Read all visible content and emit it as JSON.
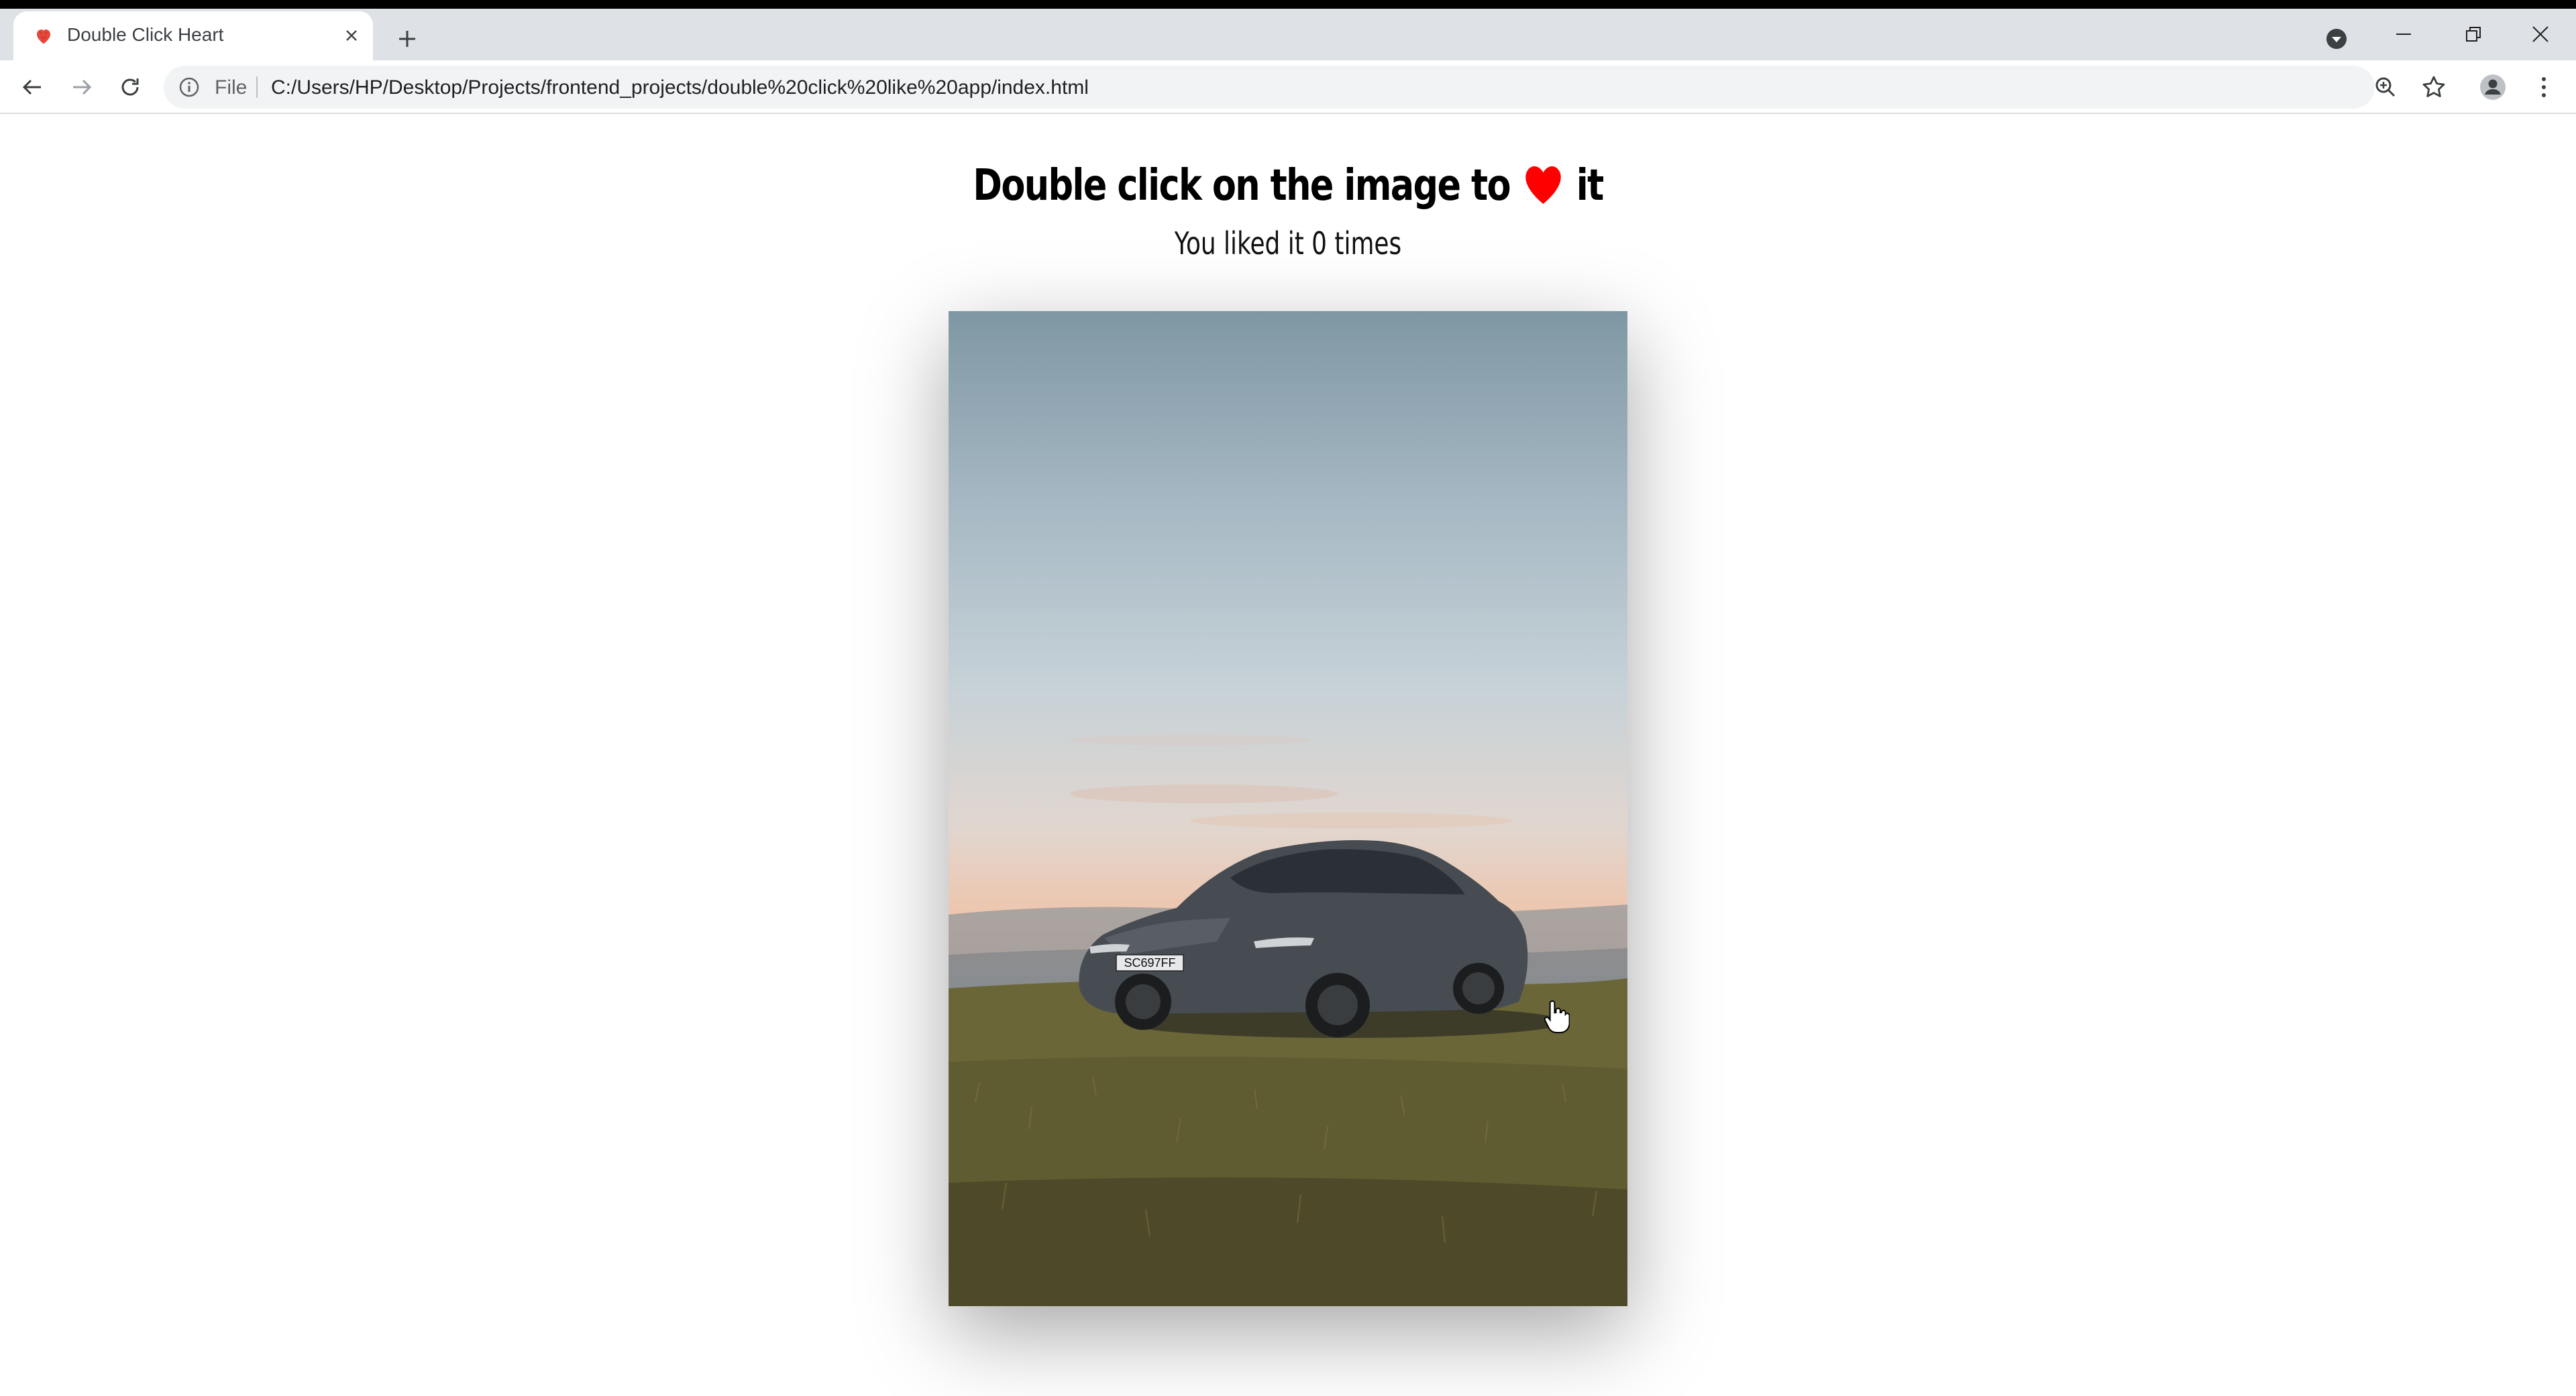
{
  "browser": {
    "tab_title": "Double Click Heart",
    "scheme_label": "File",
    "url": "C:/Users/HP/Desktop/Projects/frontend_projects/double%20click%20like%20app/index.html"
  },
  "page": {
    "headline_before": "Double click on the image to",
    "headline_after": "it",
    "likes_text_before": "You liked it",
    "likes_count": "0",
    "likes_text_after": "times",
    "heart_color": "#ff0000"
  },
  "photo": {
    "plate_text": "SC697FF"
  }
}
